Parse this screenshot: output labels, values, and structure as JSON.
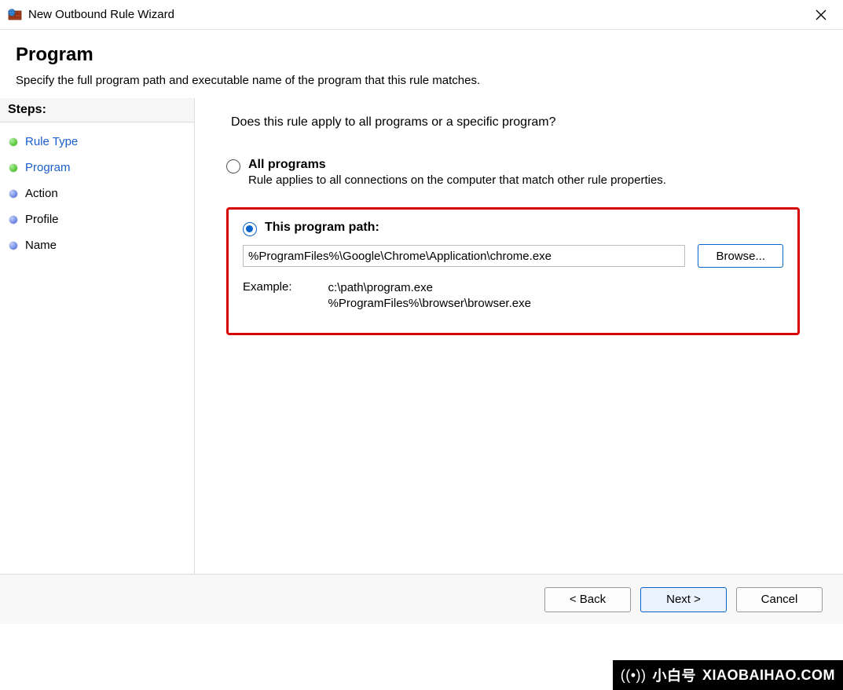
{
  "window": {
    "title": "New Outbound Rule Wizard"
  },
  "header": {
    "title": "Program",
    "subtitle": "Specify the full program path and executable name of the program that this rule matches."
  },
  "sidebar": {
    "stepsLabel": "Steps:",
    "items": [
      {
        "label": "Rule Type"
      },
      {
        "label": "Program"
      },
      {
        "label": "Action"
      },
      {
        "label": "Profile"
      },
      {
        "label": "Name"
      }
    ]
  },
  "content": {
    "question": "Does this rule apply to all programs or a specific program?",
    "allPrograms": {
      "label": "All programs",
      "desc": "Rule applies to all connections on the computer that match other rule properties."
    },
    "thisPath": {
      "label": "This program path:",
      "value": "%ProgramFiles%\\Google\\Chrome\\Application\\chrome.exe",
      "browse": "Browse...",
      "exampleLabel": "Example:",
      "example1": "c:\\path\\program.exe",
      "example2": "%ProgramFiles%\\browser\\browser.exe"
    }
  },
  "footer": {
    "back": "< Back",
    "next": "Next >",
    "cancel": "Cancel"
  },
  "watermark": {
    "line1": "@小白号  ××××××",
    "line2": "XIAOBAIHAO.COM",
    "footerCn": "小白号",
    "footerEn": "XIAOBAIHAO.COM"
  }
}
